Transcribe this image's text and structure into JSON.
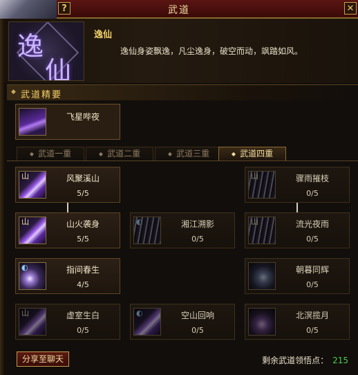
{
  "window": {
    "title": "武道",
    "help_label": "?",
    "close_label": "✕"
  },
  "header": {
    "emblem_char_1": "逸",
    "emblem_char_2": "仙",
    "school_name": "逸仙",
    "description": "逸仙身姿飘逸，凡尘逸身，破空而动，飒踏如风。"
  },
  "essence": {
    "section_label": "武道精要",
    "skill_name": "飞星哔夜",
    "icon": "ninja-leap-icon"
  },
  "tabs": [
    {
      "label": "武道一重",
      "active": false
    },
    {
      "label": "武道二重",
      "active": false
    },
    {
      "label": "武道三重",
      "active": false
    },
    {
      "label": "武道四重",
      "active": true
    }
  ],
  "skills": [
    {
      "name": "风聚溪山",
      "level": "5/5",
      "icon": "blade-icon",
      "active": true
    },
    {
      "name": "骤雨摧枝",
      "level": "0/5",
      "icon": "streak-icon",
      "active": false
    },
    {
      "name": "山火袭身",
      "level": "5/5",
      "icon": "blade-icon",
      "active": true
    },
    {
      "name": "湘江溯影",
      "level": "0/5",
      "icon": "streak-icon",
      "active": false
    },
    {
      "name": "流光夜雨",
      "level": "0/5",
      "icon": "streak-icon",
      "active": false
    },
    {
      "name": "指间春生",
      "level": "4/5",
      "icon": "orb-icon",
      "active": true
    },
    {
      "name": "朝暮同辉",
      "level": "0/5",
      "icon": "swirl-icon",
      "active": false
    },
    {
      "name": "虚室生白",
      "level": "0/5",
      "icon": "blade-icon",
      "active": false
    },
    {
      "name": "空山回响",
      "level": "0/5",
      "icon": "blade-icon",
      "active": false
    },
    {
      "name": "北溟揽月",
      "level": "0/5",
      "icon": "moon-icon",
      "active": false
    }
  ],
  "footer": {
    "share_label": "分享至聊天",
    "points_label": "剩余武道领悟点：",
    "points_value": "215"
  },
  "colors": {
    "accent_gold": "#f2d06a",
    "points_green": "#4ad24a",
    "title_bar": "#5a1512"
  }
}
